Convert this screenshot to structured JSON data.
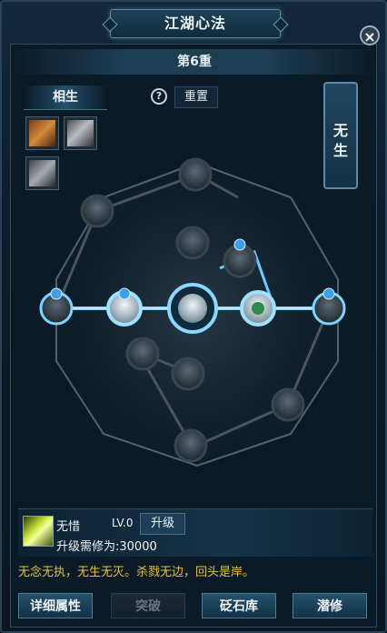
{
  "title": "江湖心法",
  "close_label": "×",
  "stage_label": "第6重",
  "tabs": {
    "active": "相生",
    "side": [
      "无",
      "生"
    ]
  },
  "help_icon_label": "?",
  "reset_label": "重置",
  "items": [
    "item-red-book-icon",
    "item-silver-crate-icon",
    "item-silver-box-icon"
  ],
  "skill": {
    "name": "无惜",
    "level": "LV.0",
    "upgrade_label": "升级",
    "cost": "升级需修为:30000"
  },
  "quote": "无念无执，无生无灭。杀戮无边，回头是岸。",
  "buttons": {
    "details": "详细属性",
    "breakthrough": "突破",
    "whetstone": "砭石库",
    "cultivate": "潜修"
  },
  "colors": {
    "accent": "#7fd4ff",
    "quote": "#e7c23a",
    "alert": "#3aa0e8"
  }
}
